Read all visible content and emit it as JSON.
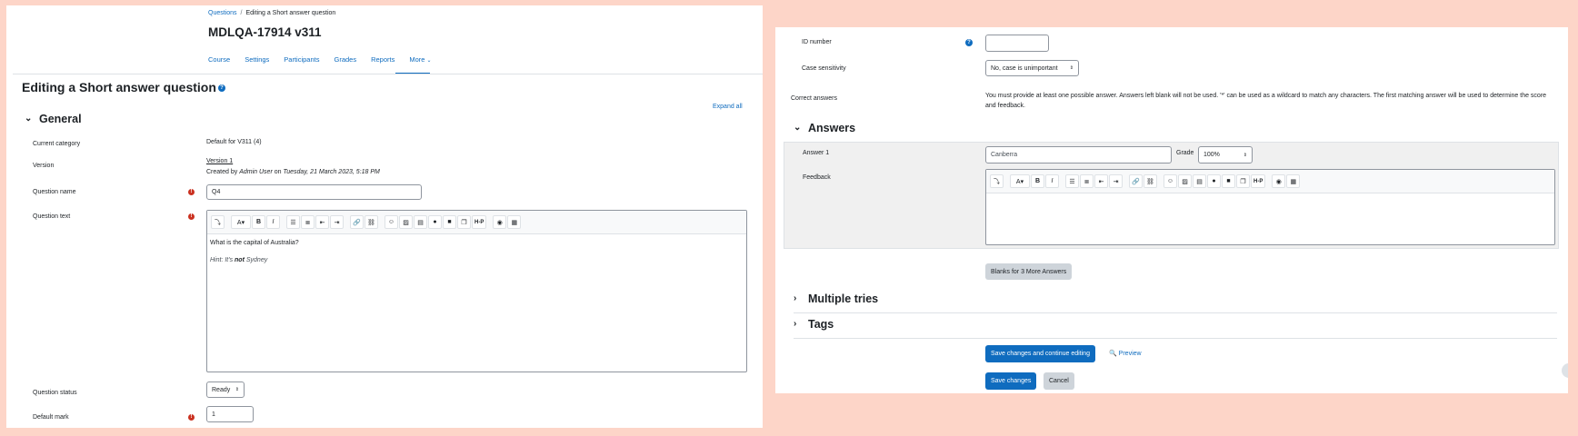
{
  "breadcrumb": {
    "root": "Questions",
    "sep": "/",
    "current": "Editing a Short answer question"
  },
  "course_title": "MDLQA-17914 v311",
  "nav": {
    "course": "Course",
    "settings": "Settings",
    "participants": "Participants",
    "grades": "Grades",
    "reports": "Reports",
    "more": "More"
  },
  "page_heading": "Editing a Short answer question",
  "expand_all": "Expand all",
  "general": {
    "title": "General",
    "current_category_label": "Current category",
    "current_category_value": "Default for V311 (4)",
    "version_label": "Version",
    "version_value": "Version 1",
    "created_prefix": "Created by",
    "created_user": "Admin User",
    "created_on": "on",
    "created_date": "Tuesday, 21 March 2023, 5:18 PM",
    "question_name_label": "Question name",
    "question_name_value": "Q4",
    "question_text_label": "Question text",
    "question_text_line1": "What is the capital of Australia?",
    "hint_prefix": "Hint: It's",
    "hint_bold": "not",
    "hint_suffix": "Sydney",
    "question_status_label": "Question status",
    "question_status_value": "Ready",
    "default_mark_label": "Default mark",
    "default_mark_value": "1"
  },
  "id_number": {
    "label": "ID number",
    "value": ""
  },
  "case_sensitivity": {
    "label": "Case sensitivity",
    "value": "No, case is unimportant"
  },
  "correct_answers": {
    "label": "Correct answers",
    "text": "You must provide at least one possible answer. Answers left blank will not be used. '*' can be used as a wildcard to match any characters. The first matching answer will be used to determine the score and feedback."
  },
  "answers": {
    "title": "Answers",
    "answer1_label": "Answer 1",
    "answer1_value": "Canberra",
    "grade_label": "Grade",
    "grade_value": "100%",
    "feedback_label": "Feedback"
  },
  "blanks_button": "Blanks for 3 More Answers",
  "multiple_tries": "Multiple tries",
  "tags": "Tags",
  "buttons": {
    "save_continue": "Save changes and continue editing",
    "preview": "Preview",
    "save": "Save changes",
    "cancel": "Cancel"
  },
  "colors": {
    "primary": "#0f6cbf",
    "required": "#ca3120",
    "background": "#fdd5c8"
  }
}
